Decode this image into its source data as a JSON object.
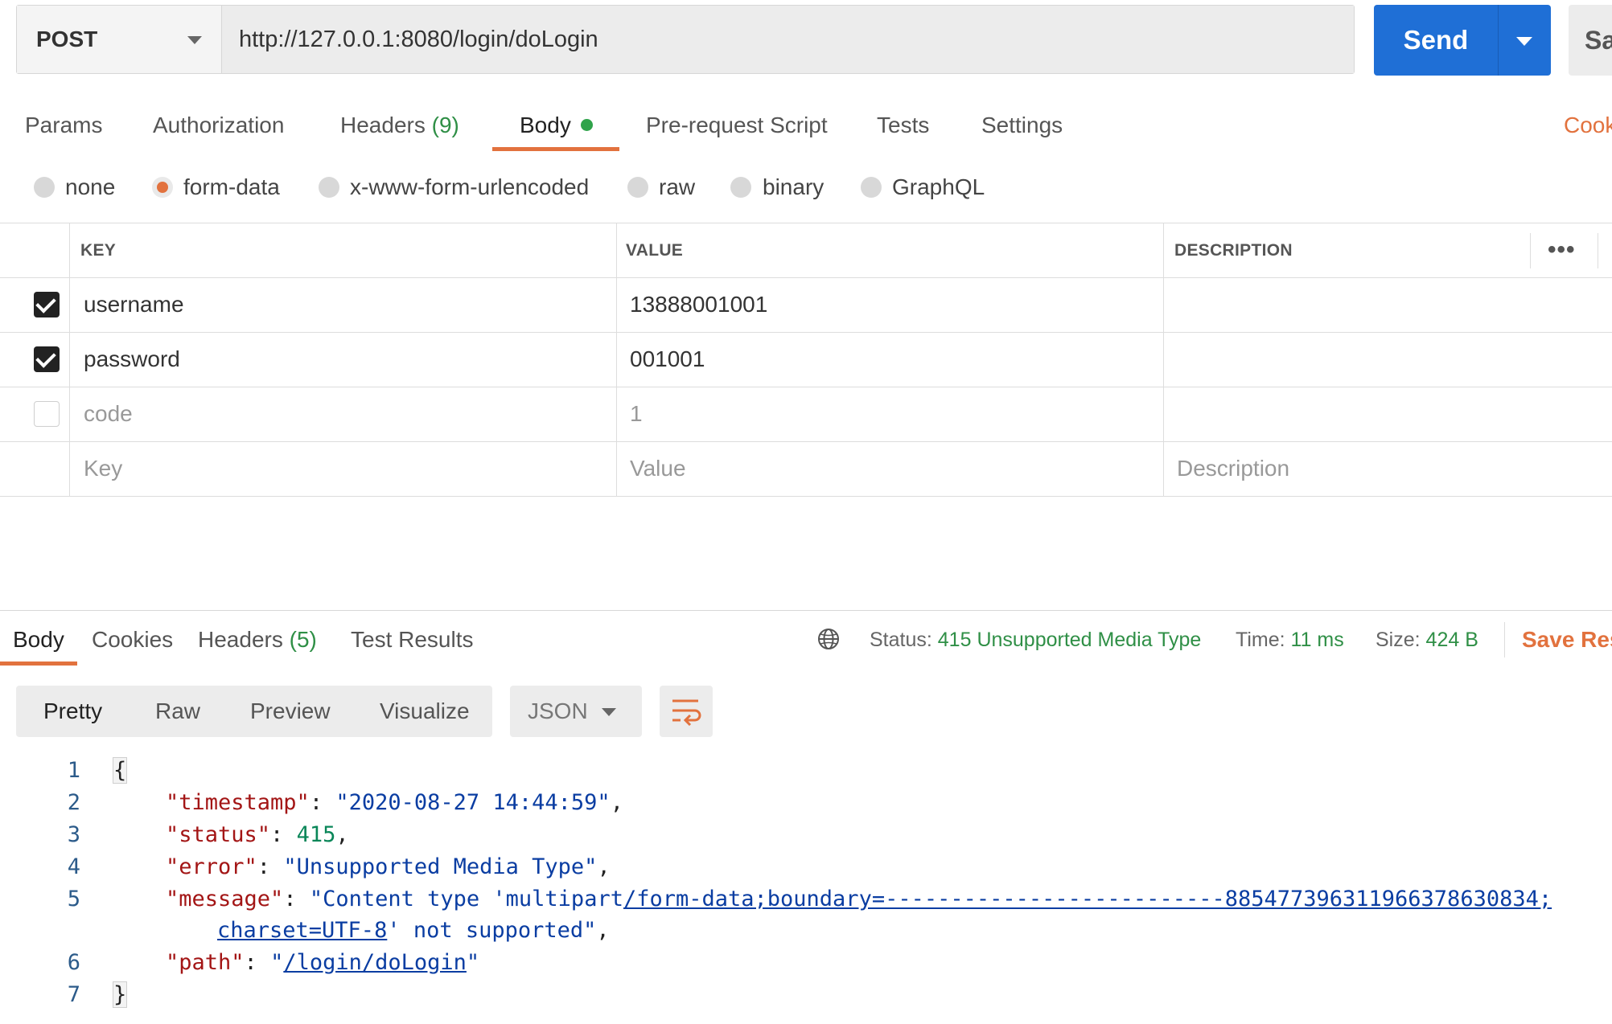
{
  "request": {
    "method": "POST",
    "url": "http://127.0.0.1:8080/login/doLogin",
    "send_label": "Send",
    "save_label_partial": "Sa"
  },
  "tabs": {
    "params": "Params",
    "authorization": "Authorization",
    "headers": "Headers",
    "headers_count": "(9)",
    "body": "Body",
    "prerequest": "Pre-request Script",
    "tests": "Tests",
    "settings": "Settings",
    "cookies_partial": "Cook"
  },
  "body_types": [
    "none",
    "form-data",
    "x-www-form-urlencoded",
    "raw",
    "binary",
    "GraphQL"
  ],
  "body_type_selected": "form-data",
  "table": {
    "headers": {
      "key": "KEY",
      "value": "VALUE",
      "description": "DESCRIPTION"
    },
    "rows": [
      {
        "key": "username",
        "value": "13888001001",
        "description": "",
        "checked": true
      },
      {
        "key": "password",
        "value": "001001",
        "description": "",
        "checked": true
      },
      {
        "key": "code",
        "value": "1",
        "description": "",
        "checked": false
      }
    ],
    "placeholders": {
      "key": "Key",
      "value": "Value",
      "description": "Description"
    }
  },
  "response": {
    "tabs": {
      "body": "Body",
      "cookies": "Cookies",
      "headers": "Headers",
      "headers_count": "(5)",
      "test_results": "Test Results"
    },
    "status_label": "Status:",
    "status_value": "415 Unsupported Media Type",
    "time_label": "Time:",
    "time_value": "11 ms",
    "size_label": "Size:",
    "size_value": "424 B",
    "save_partial": "Save Res",
    "views": [
      "Pretty",
      "Raw",
      "Preview",
      "Visualize"
    ],
    "format": "JSON",
    "line_numbers": [
      "1",
      "2",
      "3",
      "4",
      "5",
      "6",
      "7"
    ],
    "json": {
      "open_brace": "{",
      "close_brace": "}",
      "timestamp_key": "\"timestamp\"",
      "timestamp_val": "\"2020-08-27 14:44:59\"",
      "status_key": "\"status\"",
      "status_val": "415",
      "error_key": "\"error\"",
      "error_val": "\"Unsupported Media Type\"",
      "message_key": "\"message\"",
      "message_val_a": "\"Content type 'multipart",
      "message_val_b": "/form-data;boundary=--------------------------885477396311966378630834;",
      "message_val_c": "charset=UTF-8",
      "message_val_d": "' not supported\"",
      "path_key": "\"path\"",
      "path_q1": "\"",
      "path_val": "/login/doLogin",
      "path_q2": "\""
    }
  },
  "colors": {
    "accent": "#e2723e",
    "send": "#1f6fd6",
    "success": "#2f8f46"
  }
}
